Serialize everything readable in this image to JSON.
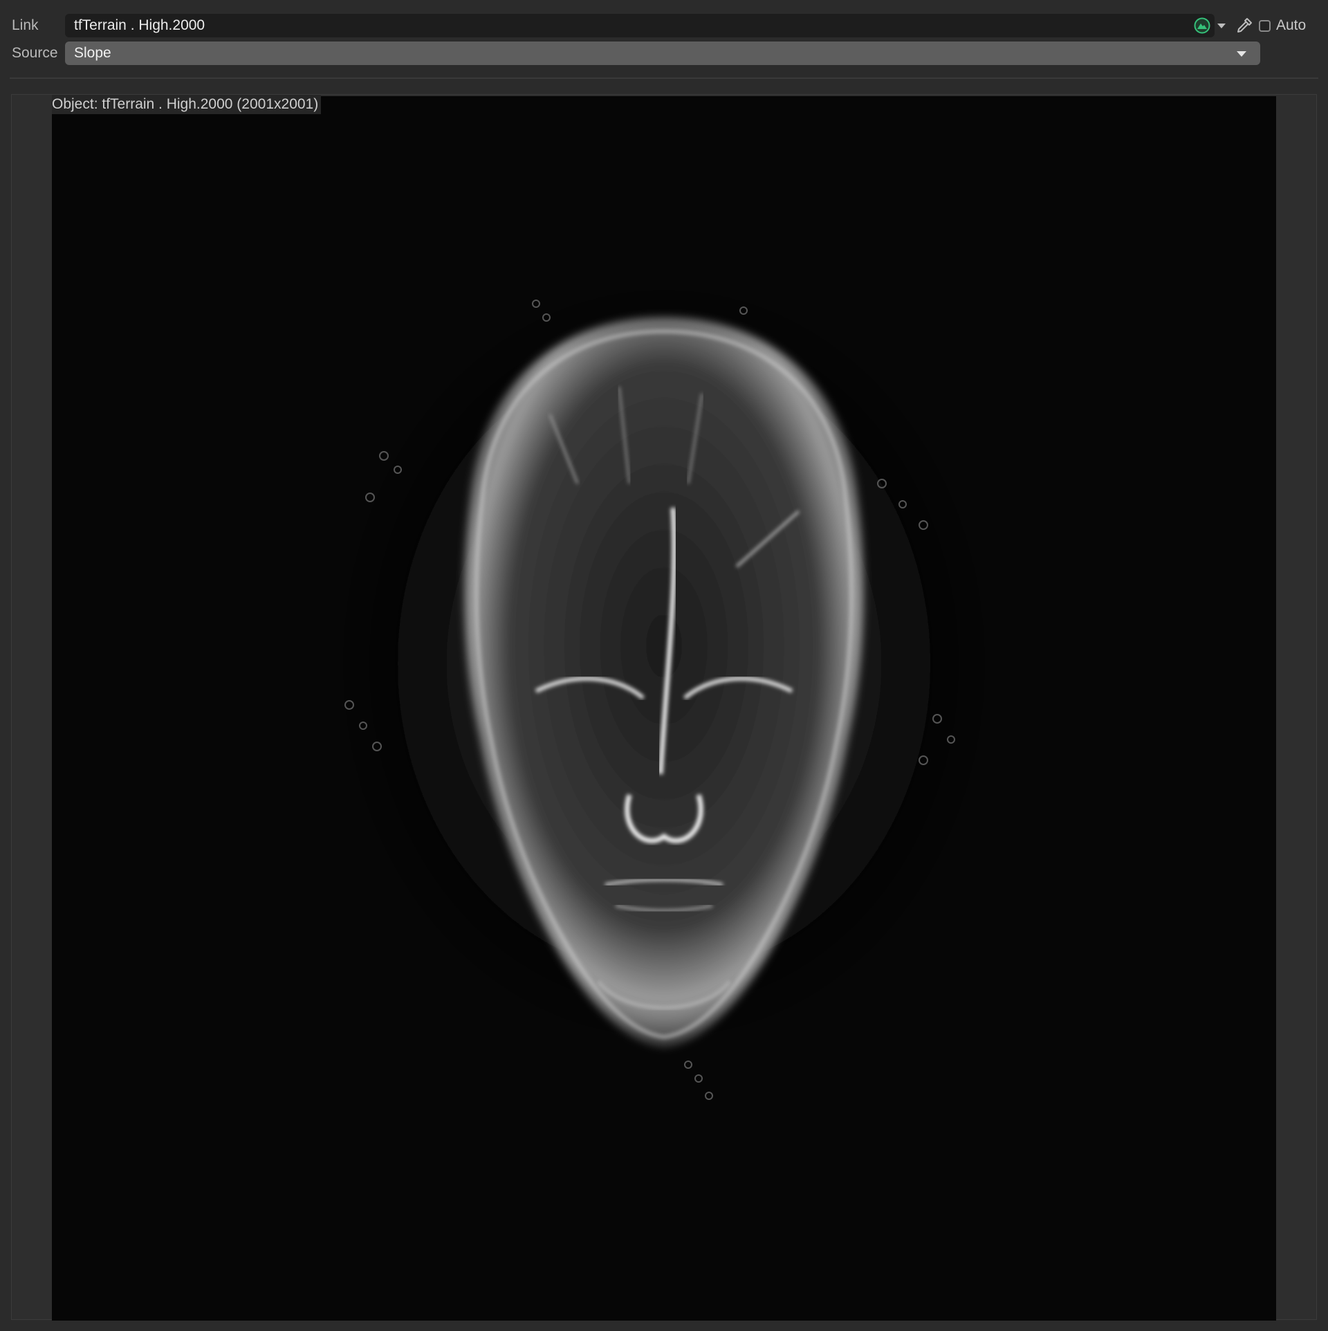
{
  "link": {
    "label": "Link",
    "value": "tfTerrain . High.2000",
    "status_icon": "globe-status-icon",
    "picker_icon": "eyedropper-icon",
    "auto_label": "Auto",
    "auto_checked": false
  },
  "source": {
    "label": "Source",
    "value": "Slope"
  },
  "viewer": {
    "caption": "Object: tfTerrain . High.2000 (2001x2001)",
    "image_description_icon": "slope-map-face-image"
  },
  "colors": {
    "panel_bg": "#2b2b2b",
    "field_bg": "#1d1d1d",
    "dropdown_bg": "#5e5e5e",
    "status_green": "#35c27a",
    "image_bg": "#060606"
  }
}
